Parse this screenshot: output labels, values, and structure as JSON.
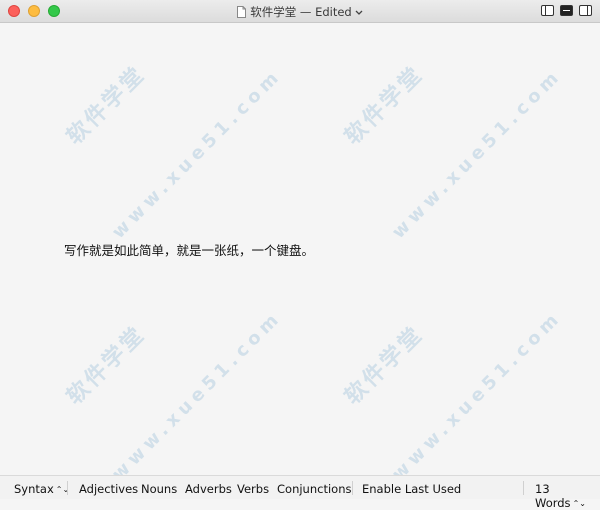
{
  "window": {
    "title": "软件学堂 — Edited",
    "chevron": "⌄"
  },
  "document": {
    "text": "写作就是如此简单，就是一张纸，一个键盘。"
  },
  "watermark": {
    "chinese": "软件学堂",
    "url": "www.xue51.com"
  },
  "statusbar": {
    "syntax_label": "Syntax",
    "syntax_arrows": "⌃⌄",
    "adjectives": "Adjectives",
    "nouns": "Nouns",
    "adverbs": "Adverbs",
    "verbs": "Verbs",
    "conjunctions": "Conjunctions",
    "enable_last_used": "Enable Last Used",
    "word_count": "13 Words",
    "word_count_arrows": "⌃⌄"
  }
}
